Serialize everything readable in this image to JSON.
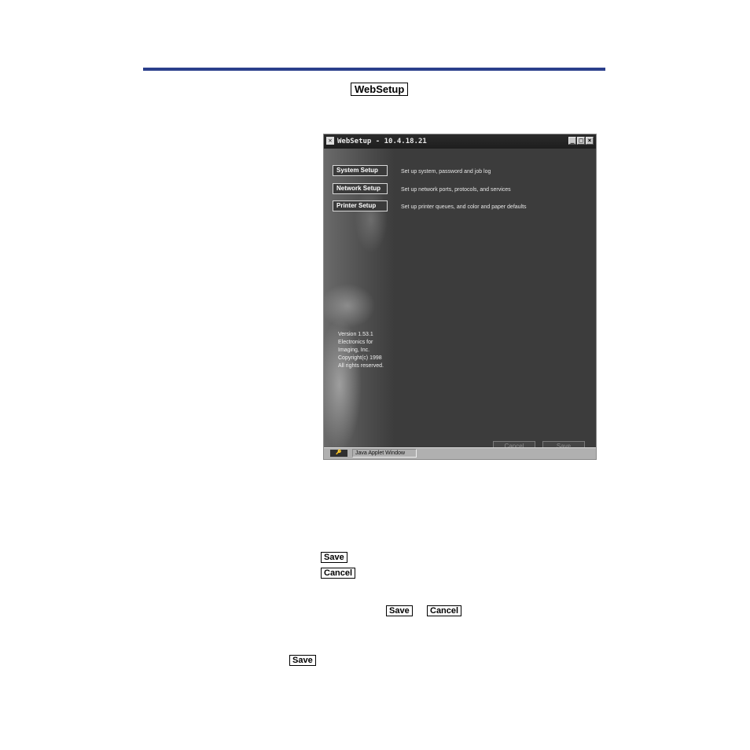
{
  "labels": {
    "websetup": "WebSetup",
    "save_1": "Save",
    "cancel_1": "Cancel",
    "save_2": "Save",
    "cancel_2": "Cancel",
    "save_3": "Save"
  },
  "window": {
    "title": "WebSetup - 10.4.18.21",
    "app_icon": "network-icon",
    "controls": {
      "minimize": "_",
      "maximize": "□",
      "close": "×"
    },
    "nav": [
      {
        "label": "System Setup",
        "description": "Set up system, password and job log"
      },
      {
        "label": "Network Setup",
        "description": "Set up network ports, protocols, and services"
      },
      {
        "label": "Printer Setup",
        "description": "Set up printer queues, and color and paper defaults"
      }
    ],
    "version_lines": [
      "Version 1.53.1",
      "Electronics for",
      "Imaging, Inc.",
      "Copyright(c) 1998",
      "All rights reserved."
    ],
    "cancel_button": "Cancel",
    "save_button": "Save",
    "status_icon": "key-icon",
    "status_text": "Java Applet Window"
  }
}
